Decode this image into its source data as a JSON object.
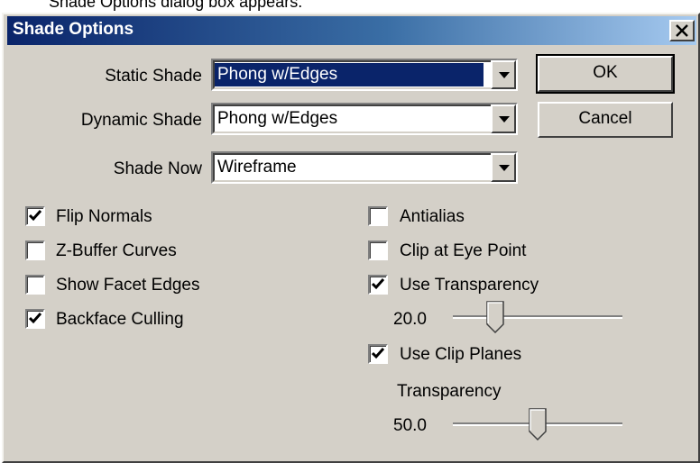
{
  "background_text": "Shade Options dialog box appears.",
  "window": {
    "title": "Shade Options"
  },
  "shade": {
    "static": {
      "label": "Static Shade",
      "value": "Phong w/Edges",
      "selected": true
    },
    "dynamic": {
      "label": "Dynamic Shade",
      "value": "Phong w/Edges"
    },
    "now": {
      "label": "Shade Now",
      "value": "Wireframe"
    }
  },
  "buttons": {
    "ok": "OK",
    "cancel": "Cancel"
  },
  "left_options": [
    {
      "label": "Flip Normals",
      "checked": true
    },
    {
      "label": "Z-Buffer Curves",
      "checked": false
    },
    {
      "label": "Show Facet Edges",
      "checked": false
    },
    {
      "label": "Backface Culling",
      "checked": true
    }
  ],
  "right_options": {
    "antialias": {
      "label": "Antialias",
      "checked": false
    },
    "clip_eye": {
      "label": "Clip at Eye Point",
      "checked": false
    },
    "use_transparency": {
      "label": "Use Transparency",
      "checked": true
    },
    "transparency_value": "20.0",
    "transparency_level": 0.22,
    "use_clip_planes": {
      "label": "Use Clip Planes",
      "checked": true
    },
    "clip_transparency_label": "Transparency",
    "clip_transparency_value": "50.0",
    "clip_transparency_level": 0.5
  },
  "colors": {
    "face": "#d4d0c8",
    "title_start": "#0a246a",
    "title_end": "#a6caf0",
    "selection": "#0a246a"
  }
}
